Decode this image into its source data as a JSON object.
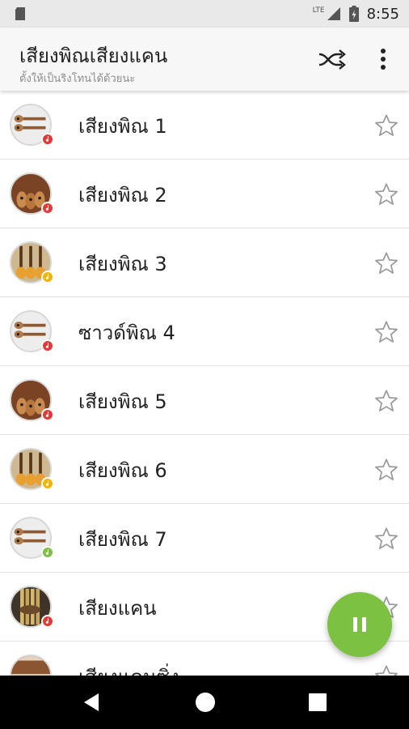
{
  "status_bar": {
    "network": "LTE",
    "time": "8:55"
  },
  "app_bar": {
    "title": "เสียงพิณเสียงแคน",
    "subtitle": "ตั้งให้เป็นริงโทนได้ด้วยนะ",
    "actions": [
      "shuffle-icon",
      "more-vert-icon"
    ]
  },
  "sounds": [
    {
      "label": "เสียงพิณ 1",
      "thumb": "pin-white",
      "badge": "#e53935"
    },
    {
      "label": "เสียงพิณ 2",
      "thumb": "pin-brown",
      "badge": "#e53935"
    },
    {
      "label": "เสียงพิณ 3",
      "thumb": "pin-gold",
      "badge": "#f4b400"
    },
    {
      "label": "ซาวด์พิณ 4",
      "thumb": "pin-white",
      "badge": "#e53935"
    },
    {
      "label": "เสียงพิณ 5",
      "thumb": "pin-brown",
      "badge": "#e53935"
    },
    {
      "label": "เสียงพิณ 6",
      "thumb": "pin-gold",
      "badge": "#f4b400"
    },
    {
      "label": "เสียงพิณ 7",
      "thumb": "pin-white",
      "badge": "#7cc142"
    },
    {
      "label": "เสียงแคน",
      "thumb": "khaen",
      "badge": "#e53935"
    },
    {
      "label": "เสียงแคนซิ่ง",
      "thumb": "khaen-brown",
      "badge": "#e53935"
    }
  ],
  "fab": {
    "icon": "pause-icon",
    "color": "#7cc142"
  },
  "nav": {
    "icons": [
      "back-icon",
      "home-icon",
      "recents-icon"
    ]
  }
}
